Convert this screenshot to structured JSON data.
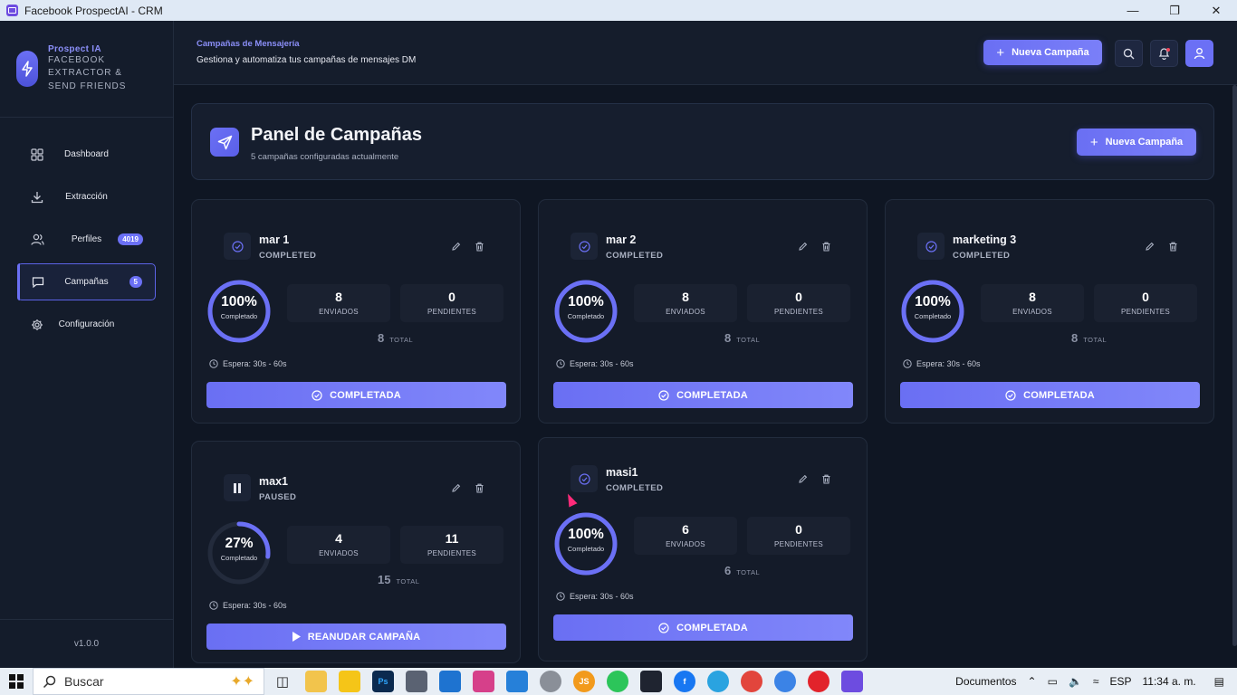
{
  "window": {
    "title": "Facebook ProspectAI - CRM"
  },
  "sidebar": {
    "brand_name": "Prospect IA",
    "brand_tagline": "FACEBOOK EXTRACTOR & SEND FRIENDS",
    "items": [
      {
        "label": "Dashboard",
        "icon": "grid-icon"
      },
      {
        "label": "Extracción",
        "icon": "download-icon"
      },
      {
        "label": "Perfiles",
        "icon": "users-icon",
        "badge": "4019"
      },
      {
        "label": "Campañas",
        "icon": "message-icon",
        "badge": "5",
        "active": true
      },
      {
        "label": "Configuración",
        "icon": "gear-icon"
      }
    ],
    "version": "v1.0.0"
  },
  "header": {
    "subtitle": "Campañas de Mensajería",
    "description": "Gestiona y automatiza tus campañas de mensajes DM",
    "new_button": "Nueva Campaña"
  },
  "panel": {
    "title": "Panel de Campañas",
    "description": "5 campañas configuradas actualmente",
    "new_button": "Nueva Campaña"
  },
  "colors": {
    "accent": "#6b70f5",
    "background": "#0f1623",
    "card": "#141b29"
  },
  "campaigns": [
    {
      "name": "mar 1",
      "status": "COMPLETED",
      "percent": "100%",
      "progress": 1.0,
      "progress_label": "Completado",
      "sent": "8",
      "sent_label": "ENVIADOS",
      "pending": "0",
      "pending_label": "PENDIENTES",
      "total": "8",
      "total_label": "TOTAL",
      "wait": "Espera: 30s - 60s",
      "button": "COMPLETADA"
    },
    {
      "name": "mar 2",
      "status": "COMPLETED",
      "percent": "100%",
      "progress": 1.0,
      "progress_label": "Completado",
      "sent": "8",
      "sent_label": "ENVIADOS",
      "pending": "0",
      "pending_label": "PENDIENTES",
      "total": "8",
      "total_label": "TOTAL",
      "wait": "Espera: 30s - 60s",
      "button": "COMPLETADA"
    },
    {
      "name": "marketing 3",
      "status": "COMPLETED",
      "percent": "100%",
      "progress": 1.0,
      "progress_label": "Completado",
      "sent": "8",
      "sent_label": "ENVIADOS",
      "pending": "0",
      "pending_label": "PENDIENTES",
      "total": "8",
      "total_label": "TOTAL",
      "wait": "Espera: 30s - 60s",
      "button": "COMPLETADA"
    },
    {
      "name": "max1",
      "status": "PAUSED",
      "percent": "27%",
      "progress": 0.27,
      "progress_label": "Completado",
      "sent": "4",
      "sent_label": "ENVIADOS",
      "pending": "11",
      "pending_label": "PENDIENTES",
      "total": "15",
      "total_label": "TOTAL",
      "wait": "Espera: 30s - 60s",
      "button": "REANUDAR CAMPAÑA"
    },
    {
      "name": "masi1",
      "status": "COMPLETED",
      "percent": "100%",
      "progress": 1.0,
      "progress_label": "Completado",
      "sent": "6",
      "sent_label": "ENVIADOS",
      "pending": "0",
      "pending_label": "PENDIENTES",
      "total": "6",
      "total_label": "TOTAL",
      "wait": "Espera: 30s - 60s",
      "button": "COMPLETADA"
    }
  ],
  "taskbar": {
    "search_placeholder": "Buscar",
    "folder_label": "Documentos",
    "language": "ESP",
    "time": "11:34 a. m."
  }
}
